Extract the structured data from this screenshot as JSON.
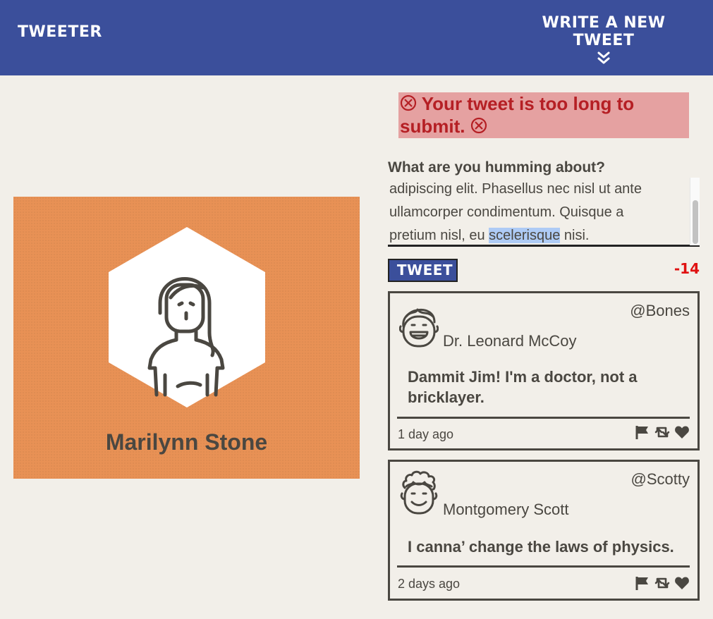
{
  "app": {
    "brand": "Tweeter",
    "compose_label": "Write a new tweet",
    "compose_icon": "chevron-double-down-icon"
  },
  "profile": {
    "name": "Marilynn Stone",
    "avatar_icon": "woman-avatar-icon",
    "background_color": "#e89155"
  },
  "composer": {
    "error_message": "Your tweet is too long to submit.",
    "error_icon": "circle-x-icon",
    "label": "What are you humming about?",
    "text_lines": [
      "adipiscing elit. Phasellus nec nisl ut ante",
      "ullamcorper condimentum. Quisque a"
    ],
    "text_last_before": "pretium nisl, eu ",
    "text_last_selected": "scelerisque",
    "text_last_after": " nisi.",
    "submit_label": "Tweet",
    "char_counter": "-14"
  },
  "tweets": [
    {
      "handle": "@Bones",
      "name": "Dr. Leonard McCoy",
      "text": "Dammit Jim! I'm a doctor, not a bricklayer.",
      "time": "1 day ago",
      "avatar_icon": "smiling-man-avatar-icon"
    },
    {
      "handle": "@Scotty",
      "name": "Montgomery Scott",
      "text": "I canna’ change the laws of physics.",
      "time": "2 days ago",
      "avatar_icon": "curly-hair-man-avatar-icon"
    }
  ],
  "actions": [
    "flag-icon",
    "retweet-icon",
    "heart-icon"
  ],
  "colors": {
    "nav": "#3b4f9b",
    "background": "#f2efe9",
    "error_bg": "#e5a1a1",
    "error_text": "#b51f24",
    "counter": "#e01111",
    "text": "#4a4741"
  }
}
